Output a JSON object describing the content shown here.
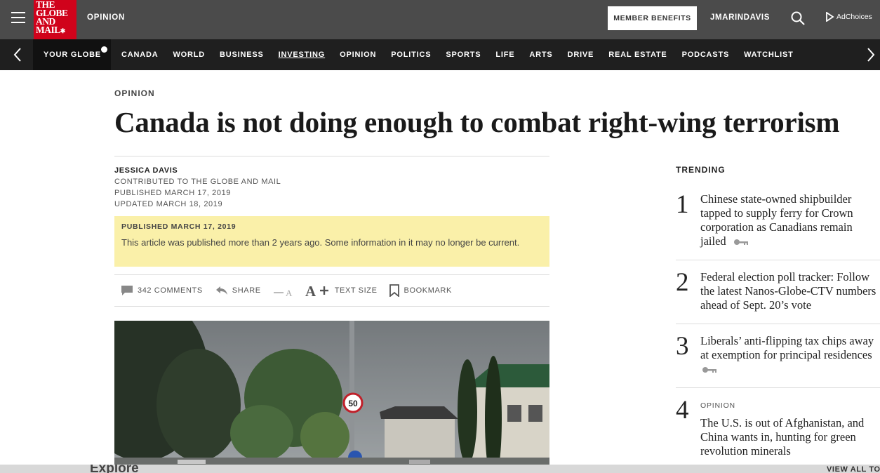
{
  "header": {
    "logo_lines": [
      "THE",
      "GLOBE",
      "AND",
      "MAIL"
    ],
    "section": "OPINION",
    "member_benefits": "MEMBER BENEFITS",
    "username": "JMARINDAVIS",
    "adchoices": "AdChoices"
  },
  "nav": {
    "your_globe": "YOUR GLOBE",
    "items": [
      "CANADA",
      "WORLD",
      "BUSINESS",
      "INVESTING",
      "OPINION",
      "POLITICS",
      "SPORTS",
      "LIFE",
      "ARTS",
      "DRIVE",
      "REAL ESTATE",
      "PODCASTS",
      "WATCHLIST"
    ]
  },
  "article": {
    "kicker": "OPINION",
    "headline": "Canada is not doing enough to combat right-wing terrorism",
    "author": "JESSICA DAVIS",
    "contributed": "CONTRIBUTED TO THE GLOBE AND MAIL",
    "published": "PUBLISHED MARCH 17, 2019",
    "updated": "UPDATED MARCH 18, 2019",
    "notice_title": "PUBLISHED MARCH 17, 2019",
    "notice_body": "This article was published more than 2 years ago. Some information in it may no longer be current.",
    "tools": {
      "comments": "342 COMMENTS",
      "share": "SHARE",
      "text_size": "TEXT SIZE",
      "bookmark": "BOOKMARK"
    },
    "speed_sign": "50"
  },
  "trending": {
    "title": "TRENDING",
    "items": [
      {
        "num": "1",
        "kicker": "",
        "lines": [
          "Chinese state-owned shipbuilder",
          "tapped to supply ferry for Crown",
          "corporation as Canadians remain",
          "jailed"
        ]
      },
      {
        "num": "2",
        "kicker": "",
        "lines": [
          "Federal election poll tracker: Follow",
          "the latest Nanos-Globe-CTV numbers",
          "ahead of Sept. 20’s vote"
        ]
      },
      {
        "num": "3",
        "kicker": "",
        "lines": [
          "Liberals’ anti-flipping tax chips away",
          "at exemption for principal residences"
        ]
      },
      {
        "num": "4",
        "kicker": "OPINION",
        "lines": [
          "The U.S. is out of Afghanistan, and",
          "China wants in, hunting for green",
          "revolution minerals"
        ]
      }
    ]
  },
  "footer": {
    "explore": "Explore",
    "view_all": "VIEW ALL TO"
  }
}
